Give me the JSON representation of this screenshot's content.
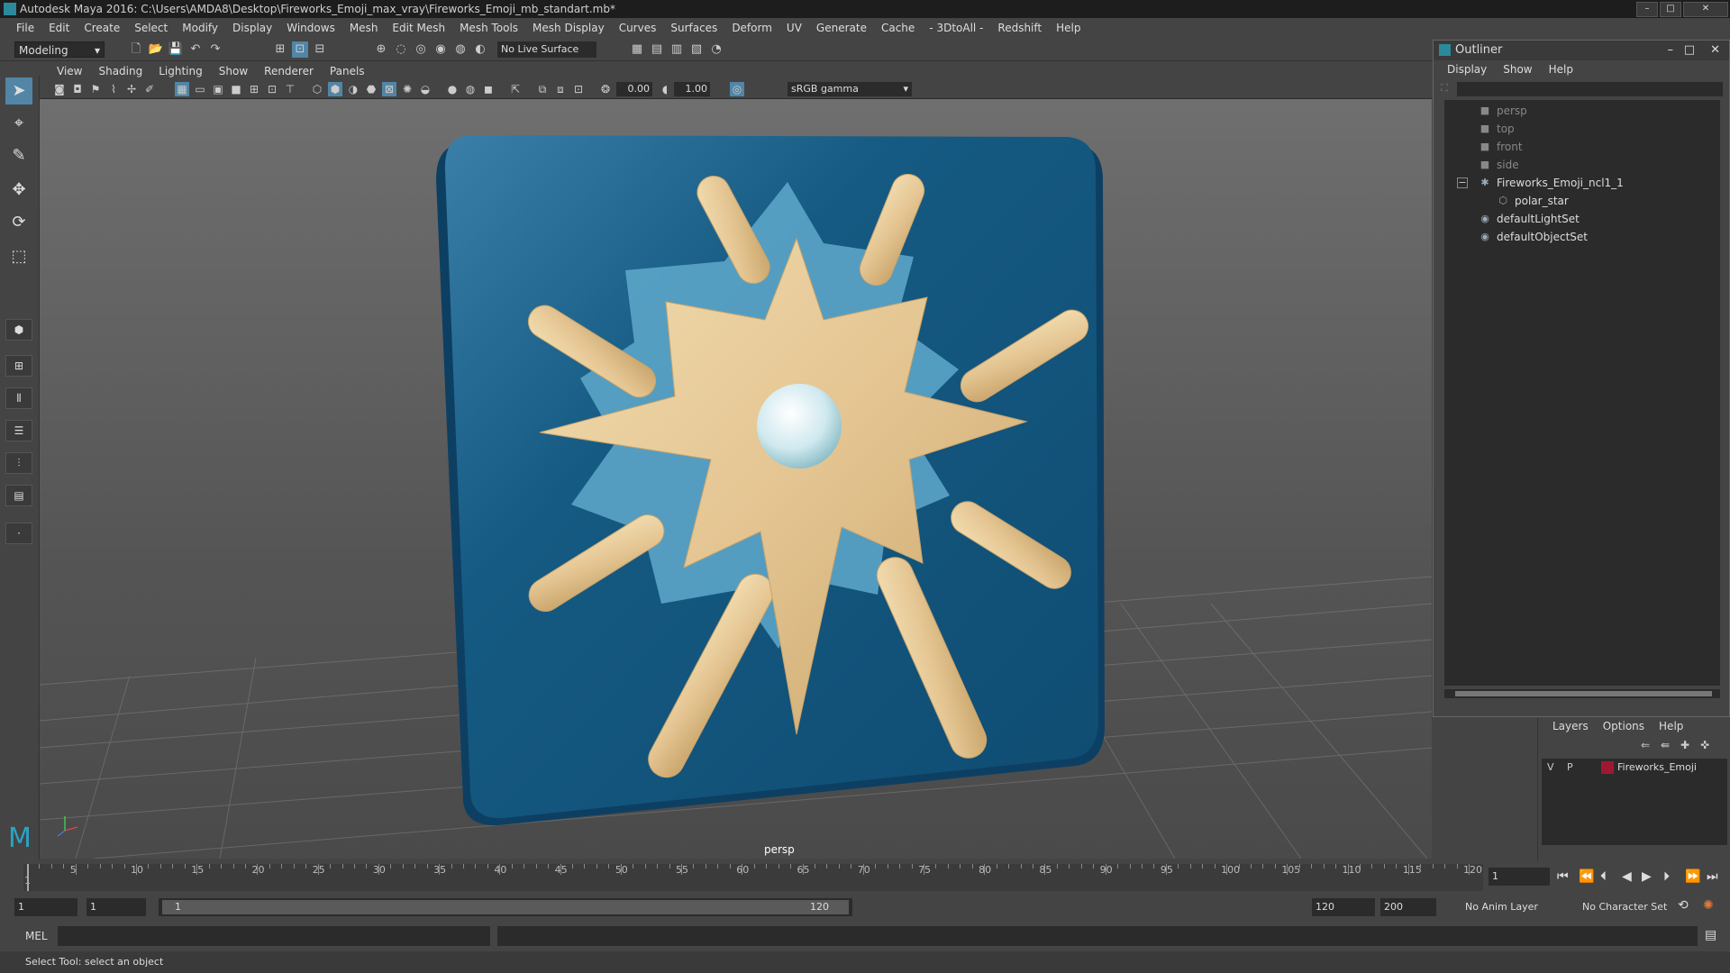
{
  "window": {
    "title": "Autodesk Maya 2016: C:\\Users\\AMDA8\\Desktop\\Fireworks_Emoji_max_vray\\Fireworks_Emoji_mb_standart.mb*"
  },
  "menubar": [
    "File",
    "Edit",
    "Create",
    "Select",
    "Modify",
    "Display",
    "Windows",
    "Mesh",
    "Edit Mesh",
    "Mesh Tools",
    "Mesh Display",
    "Curves",
    "Surfaces",
    "Deform",
    "UV",
    "Generate",
    "Cache",
    "- 3DtoAll -",
    "Redshift",
    "Help"
  ],
  "shelf": {
    "mode": "Modeling",
    "live_surface": "No Live Surface"
  },
  "panel": {
    "menus": [
      "View",
      "Shading",
      "Lighting",
      "Show",
      "Renderer",
      "Panels"
    ],
    "exposure": "0.00",
    "gamma_value": "1.00",
    "color_space": "sRGB gamma",
    "camera_label": "persp"
  },
  "outliner": {
    "title": "Outliner",
    "menus": [
      "Display",
      "Show",
      "Help"
    ],
    "items": [
      {
        "label": "persp",
        "icon": "camera-icon",
        "dim": true
      },
      {
        "label": "top",
        "icon": "camera-icon",
        "dim": true
      },
      {
        "label": "front",
        "icon": "camera-icon",
        "dim": true
      },
      {
        "label": "side",
        "icon": "camera-icon",
        "dim": true
      },
      {
        "label": "Fireworks_Emoji_ncl1_1",
        "icon": "group-icon",
        "dim": false
      },
      {
        "label": "polar_star",
        "icon": "mesh-icon",
        "dim": false
      },
      {
        "label": "defaultLightSet",
        "icon": "set-icon",
        "dim": false
      },
      {
        "label": "defaultObjectSet",
        "icon": "set-icon",
        "dim": false
      }
    ]
  },
  "layers": {
    "menus": [
      "Layers",
      "Options",
      "Help"
    ],
    "layer": {
      "v": "V",
      "p": "P",
      "name": "Fireworks_Emoji",
      "color": "#a01830"
    }
  },
  "timeline": {
    "ticks": [
      "5",
      "10",
      "15",
      "20",
      "25",
      "30",
      "35",
      "40",
      "45",
      "50",
      "55",
      "60",
      "65",
      "70",
      "75",
      "80",
      "85",
      "90",
      "95",
      "100",
      "105",
      "110",
      "115",
      "120"
    ],
    "first_tick": "1",
    "current_frame": "1"
  },
  "range": {
    "start": "1",
    "playback_start": "1",
    "slider_start": "1",
    "slider_end": "120",
    "playback_end": "120",
    "end": "200",
    "anim_layer": "No Anim Layer",
    "char_set": "No Character Set"
  },
  "cmd": {
    "label": "MEL"
  },
  "status": {
    "text": "Select Tool: select an object"
  },
  "colors": {
    "accent": "#5285a6",
    "tile": "#155a82",
    "star": "#e4c592"
  }
}
